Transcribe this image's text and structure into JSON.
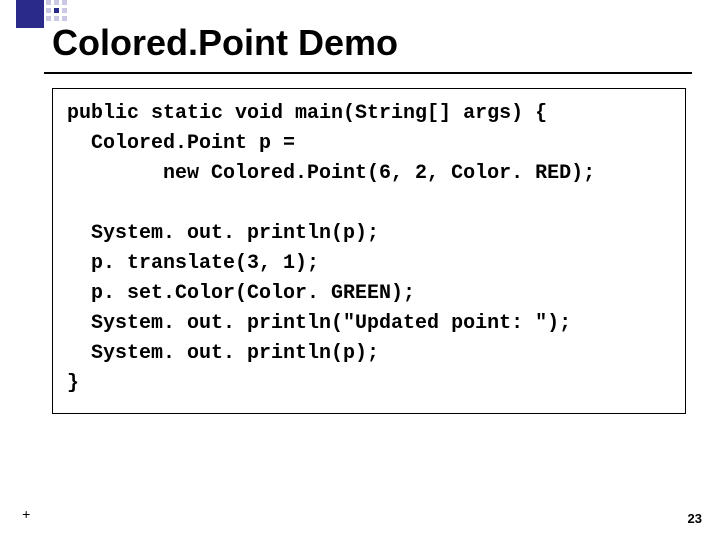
{
  "title": "Colored.Point Demo",
  "code": "public static void main(String[] args) {\n  Colored.Point p =\n        new Colored.Point(6, 2, Color. RED);\n\n  System. out. println(p);\n  p. translate(3, 1);\n  p. set.Color(Color. GREEN);\n  System. out. println(\"Updated point: \");\n  System. out. println(p);\n}",
  "footer_plus": "+",
  "page_number": "23"
}
